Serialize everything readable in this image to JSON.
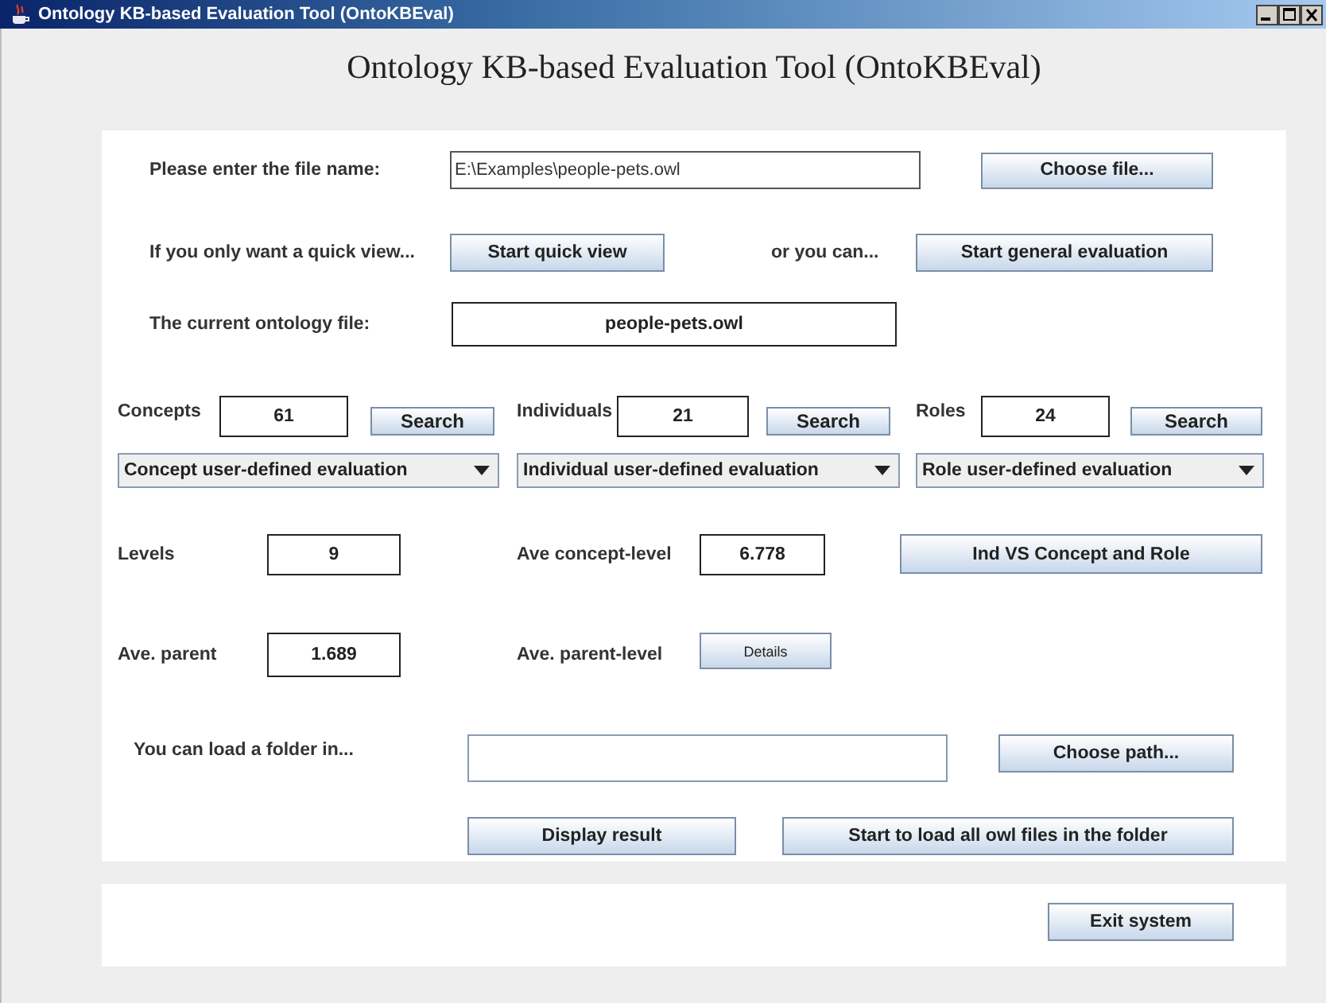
{
  "window": {
    "title": "Ontology KB-based Evaluation Tool (OntoKBEval)"
  },
  "heading": "Ontology KB-based Evaluation Tool (OntoKBEval)",
  "file_row": {
    "label": "Please enter the file name:",
    "value": "E:\\Examples\\people-pets.owl",
    "button": "Choose file..."
  },
  "quick_row": {
    "label": "If you only want a quick view...",
    "button": "Start quick view",
    "middle": "or you can...",
    "button_2": "Start general evaluation"
  },
  "current_row": {
    "label": "The current ontology file:",
    "value": "people-pets.owl"
  },
  "counts": [
    {
      "label": "Concepts",
      "value": "61",
      "button": "Search"
    },
    {
      "label": "Individuals",
      "value": "21",
      "button": "Search"
    },
    {
      "label": "Roles",
      "value": "24",
      "button": "Search"
    }
  ],
  "evaluations": [
    "Concept user-defined evaluation",
    "Individual user-defined evaluation",
    "Role user-defined evaluation"
  ],
  "levels": {
    "label": "Levels",
    "value": "9"
  },
  "ave_concept_level": {
    "label": "Ave concept-level",
    "value": "6.778"
  },
  "ind_button": "Ind VS Concept and Role",
  "ave_parent": {
    "label": "Ave. parent",
    "value": "1.689"
  },
  "ave_parent_level": {
    "label": "Ave. parent-level",
    "button": "Details"
  },
  "folder_row": {
    "label": "You can load a folder in...",
    "button": "Choose path..."
  },
  "bottom_buttons": [
    "Display result",
    "Start to load all owl files in the folder"
  ],
  "exit_button": "Exit system"
}
